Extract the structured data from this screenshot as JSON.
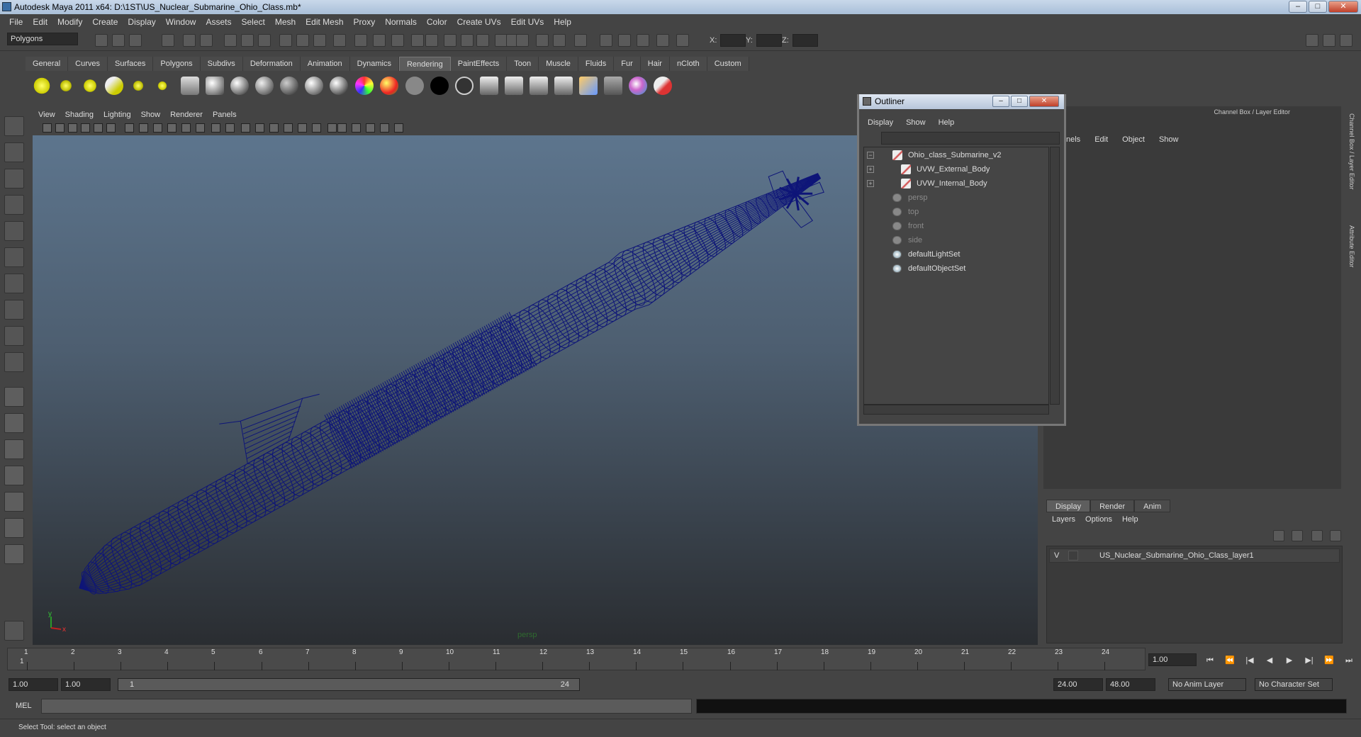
{
  "window": {
    "title": "Autodesk Maya 2011 x64: D:\\1ST\\US_Nuclear_Submarine_Ohio_Class.mb*",
    "buttons": [
      "–",
      "□",
      "✕"
    ]
  },
  "menubar": [
    "File",
    "Edit",
    "Modify",
    "Create",
    "Display",
    "Window",
    "Assets",
    "Select",
    "Mesh",
    "Edit Mesh",
    "Proxy",
    "Normals",
    "Color",
    "Create UVs",
    "Edit UVs",
    "Help"
  ],
  "statusline": {
    "mode": "Polygons",
    "x_label": "X:",
    "y_label": "Y:",
    "z_label": "Z:"
  },
  "shelf_tabs": [
    "General",
    "Curves",
    "Surfaces",
    "Polygons",
    "Subdivs",
    "Deformation",
    "Animation",
    "Dynamics",
    "Rendering",
    "PaintEffects",
    "Toon",
    "Muscle",
    "Fluids",
    "Fur",
    "Hair",
    "nCloth",
    "Custom"
  ],
  "shelf_active": "Rendering",
  "viewport": {
    "menus": [
      "View",
      "Shading",
      "Lighting",
      "Show",
      "Renderer",
      "Panels"
    ],
    "camera_label": "persp",
    "axis_y": "y",
    "axis_x": "x",
    "wire_color": "#0e1578"
  },
  "outliner": {
    "title": "Outliner",
    "menus": [
      "Display",
      "Show",
      "Help"
    ],
    "items": [
      {
        "label": "Ohio_class_Submarine_v2",
        "expander": "−",
        "icon": "mesh-icon",
        "dim": false
      },
      {
        "label": "UVW_External_Body",
        "expander": "+",
        "icon": "mesh-icon",
        "dim": false
      },
      {
        "label": "UVW_Internal_Body",
        "expander": "+",
        "icon": "mesh-icon",
        "dim": false
      },
      {
        "label": "persp",
        "expander": "",
        "icon": "camera-icon",
        "dim": true
      },
      {
        "label": "top",
        "expander": "",
        "icon": "camera-icon",
        "dim": true
      },
      {
        "label": "front",
        "expander": "",
        "icon": "camera-icon",
        "dim": true
      },
      {
        "label": "side",
        "expander": "",
        "icon": "camera-icon",
        "dim": true
      },
      {
        "label": "defaultLightSet",
        "expander": "",
        "icon": "set-icon",
        "dim": false
      },
      {
        "label": "defaultObjectSet",
        "expander": "",
        "icon": "set-icon",
        "dim": false
      }
    ]
  },
  "channel_box": {
    "title": "Channel Box / Layer Editor",
    "menus": [
      "nels",
      "Edit",
      "Object",
      "Show"
    ],
    "side_tabs": [
      "Channel Box / Layer Editor",
      "Attribute Editor"
    ]
  },
  "layer_editor": {
    "tabs": [
      "Display",
      "Render",
      "Anim"
    ],
    "active_tab": "Display",
    "menus": [
      "Layers",
      "Options",
      "Help"
    ],
    "layers": [
      {
        "visible": "V",
        "name": "US_Nuclear_Submarine_Ohio_Class_layer1"
      }
    ]
  },
  "timeline": {
    "frames": [
      "1",
      "2",
      "3",
      "4",
      "5",
      "6",
      "7",
      "8",
      "9",
      "10",
      "11",
      "12",
      "13",
      "14",
      "15",
      "16",
      "17",
      "18",
      "19",
      "20",
      "21",
      "22",
      "23",
      "24"
    ],
    "start_label": "1",
    "current_frame": "1.00"
  },
  "range": {
    "start": "1.00",
    "playback_start": "1.00",
    "slider_start": "1",
    "slider_end": "24",
    "playback_end": "24.00",
    "end": "48.00",
    "anim_layer": "No Anim Layer",
    "character_set": "No Character Set"
  },
  "command_line": {
    "label": "MEL"
  },
  "help_line": "Select Tool: select an object"
}
